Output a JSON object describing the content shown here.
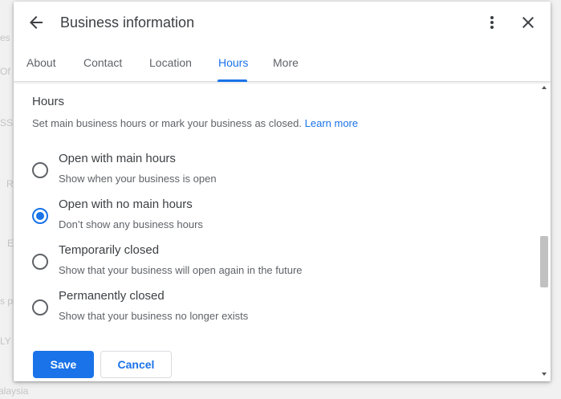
{
  "background": {
    "fragments": [
      "es",
      "Of",
      "SS",
      "R",
      "E",
      "s pr",
      "LY",
      "alaysia"
    ]
  },
  "dialog": {
    "title": "Business information",
    "tabs": [
      {
        "label": "About"
      },
      {
        "label": "Contact"
      },
      {
        "label": "Location"
      },
      {
        "label": "Hours",
        "active": true
      },
      {
        "label": "More"
      }
    ]
  },
  "hours": {
    "title": "Hours",
    "description": "Set main business hours or mark your business as closed.",
    "learn_more": "Learn more",
    "options": [
      {
        "label": "Open with main hours",
        "sub": "Show when your business is open",
        "checked": false
      },
      {
        "label": "Open with no main hours",
        "sub": "Don’t show any business hours",
        "checked": true
      },
      {
        "label": "Temporarily closed",
        "sub": "Show that your business will open again in the future",
        "checked": false
      },
      {
        "label": "Permanently closed",
        "sub": "Show that your business no longer exists",
        "checked": false
      }
    ]
  },
  "actions": {
    "save": "Save",
    "cancel": "Cancel"
  },
  "colors": {
    "accent": "#1a73e8",
    "text": "#3c4043",
    "secondary": "#5f6368"
  },
  "icons": {
    "back": "arrow-back-icon",
    "more": "more-vert-icon",
    "close": "close-icon"
  }
}
